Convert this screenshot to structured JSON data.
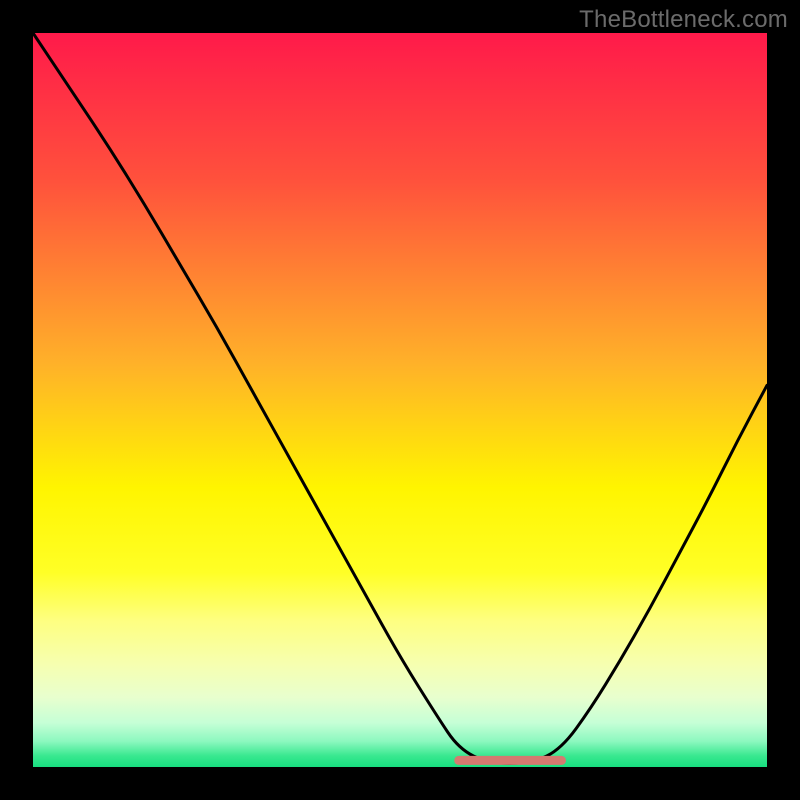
{
  "watermark": "TheBottleneck.com",
  "colors": {
    "frame": "#000000",
    "curve": "#000000",
    "flat_segment": "#d57a70",
    "gradient_stops": [
      {
        "offset": 0.0,
        "color": "#ff1a4a"
      },
      {
        "offset": 0.2,
        "color": "#ff513c"
      },
      {
        "offset": 0.45,
        "color": "#ffb129"
      },
      {
        "offset": 0.62,
        "color": "#fff500"
      },
      {
        "offset": 0.735,
        "color": "#ffff26"
      },
      {
        "offset": 0.8,
        "color": "#feff80"
      },
      {
        "offset": 0.86,
        "color": "#f6ffb0"
      },
      {
        "offset": 0.905,
        "color": "#e8ffce"
      },
      {
        "offset": 0.94,
        "color": "#c5ffd6"
      },
      {
        "offset": 0.965,
        "color": "#8cf8bf"
      },
      {
        "offset": 0.985,
        "color": "#38e88f"
      },
      {
        "offset": 1.0,
        "color": "#17df80"
      }
    ]
  },
  "chart_data": {
    "type": "line",
    "title": "",
    "xlabel": "",
    "ylabel": "",
    "xlim": [
      0,
      100
    ],
    "ylim": [
      0,
      100
    ],
    "x": [
      0,
      5,
      10,
      15,
      20,
      25,
      30,
      35,
      40,
      45,
      50,
      55,
      58,
      62,
      68,
      72,
      76,
      80,
      84,
      88,
      92,
      96,
      100
    ],
    "values": [
      100,
      92.5,
      85,
      77,
      68.5,
      60,
      51,
      42,
      33,
      24,
      15,
      7,
      2.5,
      0.5,
      0.5,
      2.5,
      8,
      14.5,
      21.5,
      29,
      36.5,
      44.5,
      52
    ],
    "flat_segment_x": [
      58,
      72
    ],
    "flat_segment_y": 0.9,
    "note": "Curve shape read visually; x is approx. horizontal percent, y is approx. vertical percent from bottom."
  }
}
